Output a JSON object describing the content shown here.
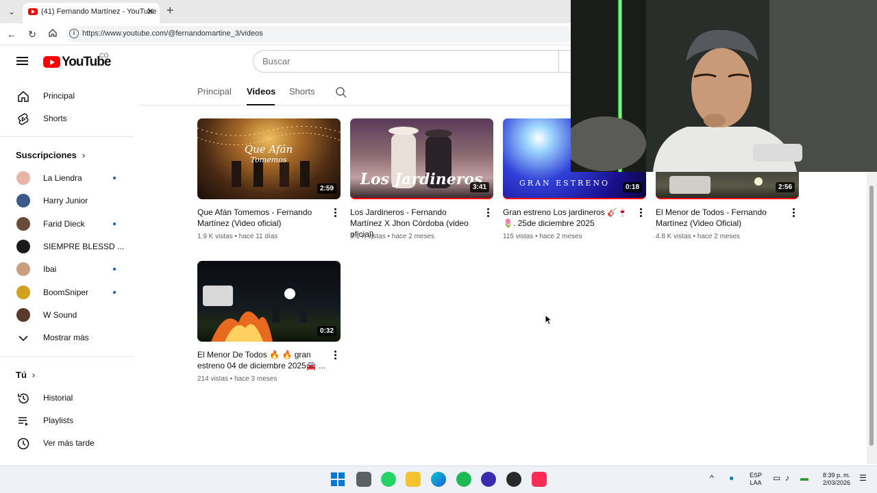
{
  "browser": {
    "tab_title": "(41) Fernando Martínez - YouTube",
    "url": "https://www.youtube.com/@fernandomartine_3/videos"
  },
  "youtube": {
    "logo_text": "YouTube",
    "country": "CO",
    "search_placeholder": "Buscar"
  },
  "sidebar": {
    "nav": [
      {
        "label": "Principal"
      },
      {
        "label": "Shorts"
      }
    ],
    "subscriptions_heading": "Suscripciones",
    "subscriptions": [
      {
        "label": "La Liendra",
        "new": true,
        "color": "#e8b4a8"
      },
      {
        "label": "Harry Junior",
        "new": false,
        "color": "#3a5a8a"
      },
      {
        "label": "Farid Dieck",
        "new": true,
        "color": "#6a4a3a"
      },
      {
        "label": "SIEMPRE BLESSD ...",
        "new": false,
        "color": "#1a1a1a"
      },
      {
        "label": "Ibai",
        "new": true,
        "color": "#c8a080"
      },
      {
        "label": "BoomSniper",
        "new": true,
        "color": "#d4a020"
      },
      {
        "label": "W Sound",
        "new": false,
        "color": "#5a3a2a"
      }
    ],
    "show_more": "Mostrar más",
    "you_heading": "Tú",
    "you_items": [
      {
        "label": "Historial"
      },
      {
        "label": "Playlists"
      },
      {
        "label": "Ver más tarde"
      }
    ]
  },
  "channel_tabs": [
    "Principal",
    "Videos",
    "Shorts"
  ],
  "videos": [
    {
      "title": "Que Afán Tomemos - Fernando Martínez (Video oficial)",
      "views": "1.9 K vistas",
      "age": "hace 11 días",
      "duration": "2:59"
    },
    {
      "title": "Los Jardineros - Fernando Martínez X Jhon Córdoba (video oficial)",
      "views": "3.1 K vistas",
      "age": "hace 2 meses",
      "duration": "3:41"
    },
    {
      "title": "Gran estreno Los jardineros 🎸🍷 🌷. 25de diciembre 2025",
      "views": "115 vistas",
      "age": "hace 2 meses",
      "duration": "0:18"
    },
    {
      "title": "El Menor de Todos - Fernando Martínez (Video Oficial)",
      "views": "4.8 K vistas",
      "age": "hace 2 meses",
      "duration": "2:56"
    },
    {
      "title": "El Menor De Todos 🔥 🔥 gran estreno 04 de diciembre 2025🚘 ...",
      "views": "214 vistas",
      "age": "hace 3 meses",
      "duration": "0:32"
    }
  ],
  "taskbar": {
    "lang_top": "ESP",
    "lang_bottom": "LAA",
    "time": "8:39 p. m.",
    "date": "2/03/2026"
  },
  "colors": {
    "youtube_red": "#ff0000",
    "unread_dot": "#065fd4"
  }
}
